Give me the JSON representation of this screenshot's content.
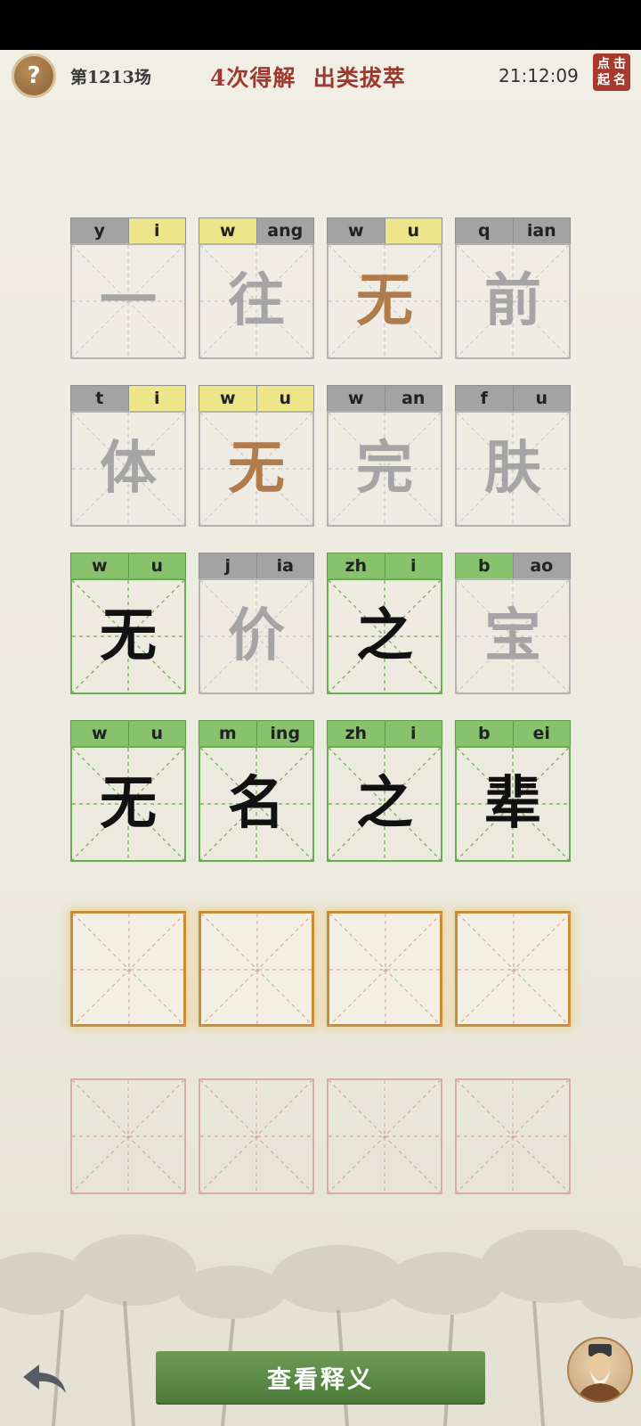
{
  "header": {
    "help_icon": "?",
    "round": "第1213场",
    "result": "4次得解  出类拔萃",
    "time": "21:12:09",
    "seal_chars": [
      "点",
      "击",
      "起",
      "名"
    ]
  },
  "rows": [
    [
      {
        "py": [
          "y",
          "i"
        ],
        "py_state": [
          "gray",
          "yellow"
        ],
        "char": "一",
        "char_state": "gray"
      },
      {
        "py": [
          "w",
          "ang"
        ],
        "py_state": [
          "yellow",
          "gray"
        ],
        "char": "往",
        "char_state": "gray"
      },
      {
        "py": [
          "w",
          "u"
        ],
        "py_state": [
          "gray",
          "yellow"
        ],
        "char": "无",
        "char_state": "brown"
      },
      {
        "py": [
          "q",
          "ian"
        ],
        "py_state": [
          "gray",
          "gray"
        ],
        "char": "前",
        "char_state": "gray"
      }
    ],
    [
      {
        "py": [
          "t",
          "i"
        ],
        "py_state": [
          "gray",
          "yellow"
        ],
        "char": "体",
        "char_state": "gray"
      },
      {
        "py": [
          "w",
          "u"
        ],
        "py_state": [
          "yellow",
          "yellow"
        ],
        "char": "无",
        "char_state": "brown"
      },
      {
        "py": [
          "w",
          "an"
        ],
        "py_state": [
          "gray",
          "gray"
        ],
        "char": "完",
        "char_state": "gray"
      },
      {
        "py": [
          "f",
          "u"
        ],
        "py_state": [
          "gray",
          "gray"
        ],
        "char": "肤",
        "char_state": "gray"
      }
    ],
    [
      {
        "py": [
          "w",
          "u"
        ],
        "py_state": [
          "green",
          "green"
        ],
        "char": "无",
        "char_state": "black",
        "tile": "green"
      },
      {
        "py": [
          "j",
          "ia"
        ],
        "py_state": [
          "gray",
          "gray"
        ],
        "char": "价",
        "char_state": "gray"
      },
      {
        "py": [
          "zh",
          "i"
        ],
        "py_state": [
          "green",
          "green"
        ],
        "char": "之",
        "char_state": "black",
        "tile": "green"
      },
      {
        "py": [
          "b",
          "ao"
        ],
        "py_state": [
          "green",
          "gray"
        ],
        "char": "宝",
        "char_state": "gray"
      }
    ],
    [
      {
        "py": [
          "w",
          "u"
        ],
        "py_state": [
          "green",
          "green"
        ],
        "char": "无",
        "char_state": "black",
        "tile": "green"
      },
      {
        "py": [
          "m",
          "ing"
        ],
        "py_state": [
          "green",
          "green"
        ],
        "char": "名",
        "char_state": "black",
        "tile": "green"
      },
      {
        "py": [
          "zh",
          "i"
        ],
        "py_state": [
          "green",
          "green"
        ],
        "char": "之",
        "char_state": "black",
        "tile": "green"
      },
      {
        "py": [
          "b",
          "ei"
        ],
        "py_state": [
          "green",
          "green"
        ],
        "char": "辈",
        "char_state": "black",
        "tile": "green"
      }
    ]
  ],
  "footer": {
    "view_label": "查看释义"
  },
  "colors": {
    "gray": "#a3a3a3",
    "yellow": "#ede58a",
    "green": "#88c26d",
    "accent_red": "#9c3a2f",
    "button_green": "#5a8a45"
  },
  "icons": {
    "back": "back-arrow-icon",
    "help": "help-icon",
    "avatar": "sage-avatar-icon"
  }
}
